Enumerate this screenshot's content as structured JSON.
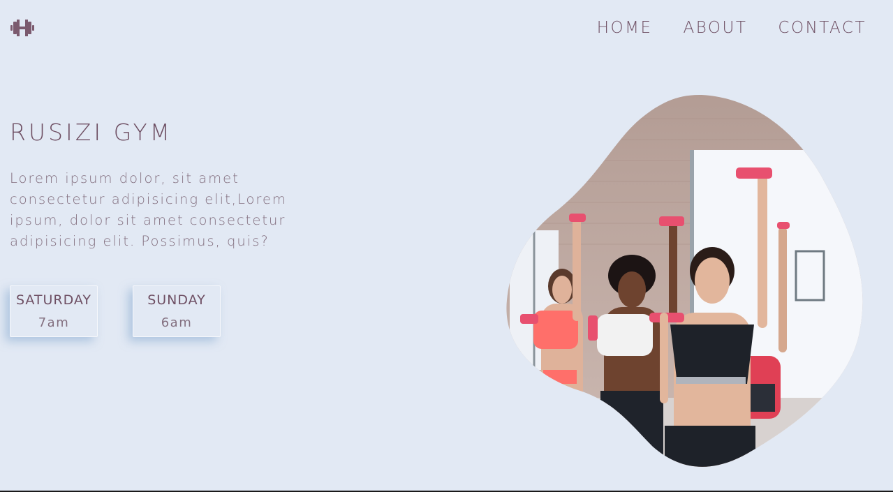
{
  "header": {
    "logo_icon": "dumbbell-icon",
    "nav": [
      {
        "label": "HOME"
      },
      {
        "label": "ABOUT"
      },
      {
        "label": "CONTACT"
      }
    ]
  },
  "hero": {
    "title": "RUSIZI GYM",
    "description": "Lorem ipsum dolor, sit amet consectetur adipisicing elit,Lorem ipsum, dolor sit amet consectetur adipisicing elit. Possimus, quis?",
    "schedule": [
      {
        "day": "SATURDAY",
        "time": "7am"
      },
      {
        "day": "SUNDAY",
        "time": "6am"
      }
    ]
  },
  "colors": {
    "background": "#e2e9f4",
    "text": "#6e4f63",
    "accent": "#e8506f"
  }
}
